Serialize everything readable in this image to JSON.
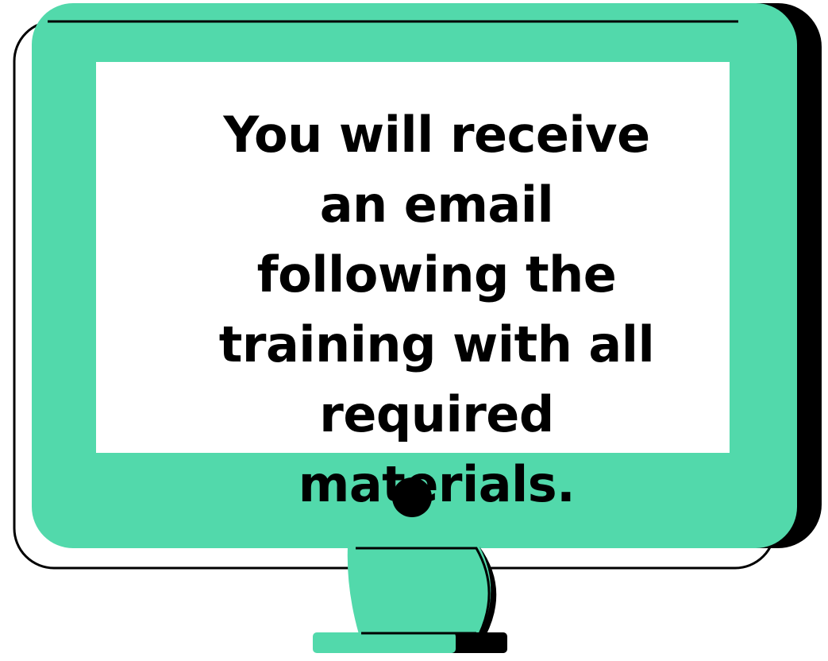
{
  "screen": {
    "message": "You will receive an email following the training with all required materials."
  },
  "monitor": {
    "icon": "desktop-monitor-icon",
    "colors": {
      "bezel": "#52D9AB",
      "shadow": "#000000",
      "screen": "#FFFFFF",
      "outline": "#000000"
    }
  }
}
